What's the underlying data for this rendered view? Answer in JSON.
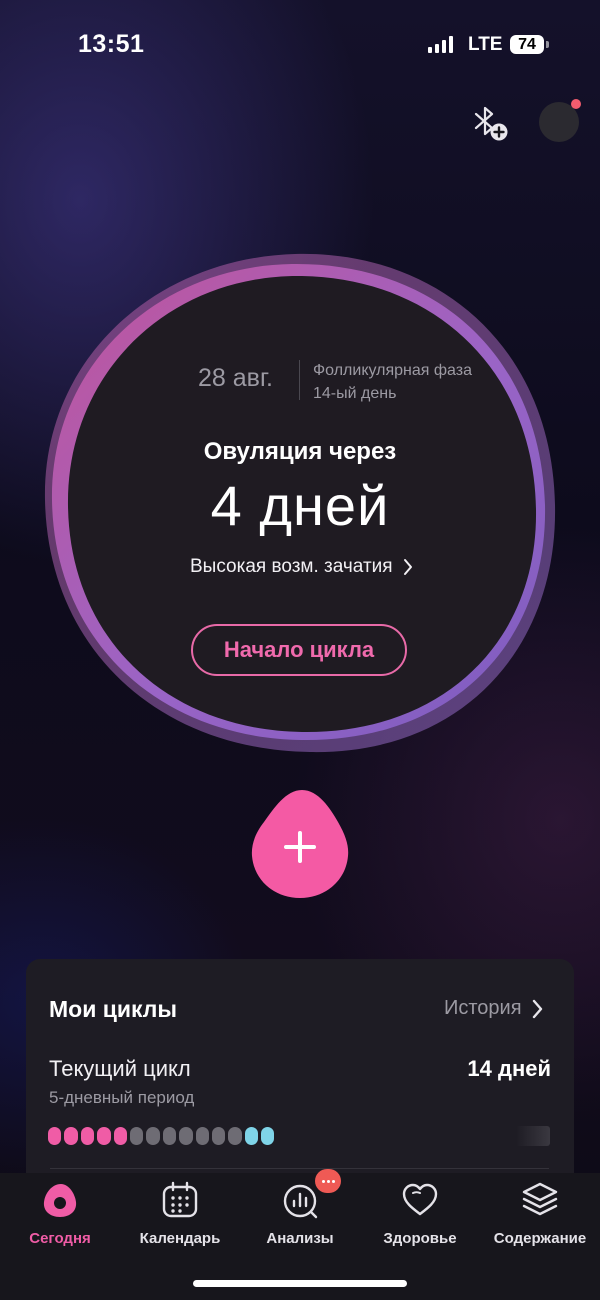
{
  "status_bar": {
    "time": "13:51",
    "network": "LTE",
    "battery": "74"
  },
  "top_actions": {
    "bluetooth_icon": "bluetooth-add-icon",
    "profile_badge_color": "#f25c6e"
  },
  "cycle_view": {
    "date": "28 авг.",
    "phase_name": "Фолликулярная фаза",
    "phase_day": "14-ый день",
    "ovulation_label": "Овуляция через",
    "ovulation_value": "4 дней",
    "fertility": "Высокая возм. зачатия",
    "start_cycle_label": "Начало цикла",
    "accent": "#f05ca6"
  },
  "cycles_card": {
    "title": "Мои циклы",
    "history_label": "История",
    "current_cycle_label": "Текущий цикл",
    "current_cycle_days": "14 дней",
    "period_length": "5-дневный период",
    "days": [
      "period",
      "period",
      "period",
      "period",
      "period",
      "normal",
      "normal",
      "normal",
      "normal",
      "normal",
      "normal",
      "normal",
      "fertile",
      "fertile"
    ]
  },
  "tabs": [
    {
      "label": "Сегодня",
      "icon": "today-icon",
      "active": true
    },
    {
      "label": "Календарь",
      "icon": "calendar-icon",
      "active": false
    },
    {
      "label": "Анализы",
      "icon": "analytics-icon",
      "active": false
    },
    {
      "label": "Здоровье",
      "icon": "heart-icon",
      "active": false
    },
    {
      "label": "Содержание",
      "icon": "layers-icon",
      "active": false
    }
  ]
}
